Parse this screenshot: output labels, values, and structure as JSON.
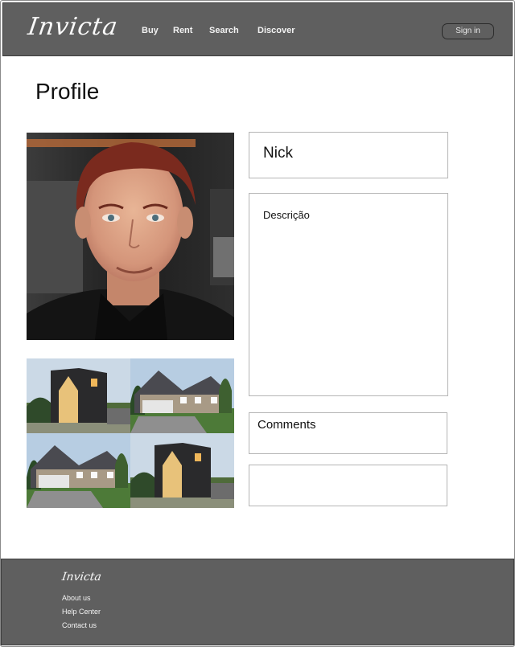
{
  "header": {
    "logo": "Invicta",
    "nav": [
      "Buy",
      "Rent",
      "Search",
      "Discover"
    ],
    "sign_in": "Sign in"
  },
  "page": {
    "title": "Profile"
  },
  "profile": {
    "name": "Nick",
    "description_label": "Descrição",
    "comments_label": "Comments"
  },
  "gallery": {
    "items": [
      "modern-dark-house",
      "suburban-house",
      "suburban-house",
      "modern-dark-house"
    ]
  },
  "footer": {
    "logo": "Invicta",
    "links": [
      "About us",
      "Help Center",
      "Contact us"
    ]
  }
}
